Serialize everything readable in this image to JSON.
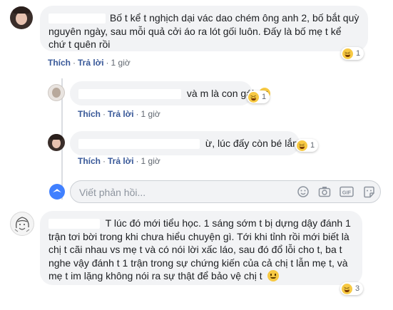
{
  "comments": [
    {
      "id": "c1",
      "text_line1": "Bố t kể t nghịch dại vác dao chém ông anh 2, bố bắt quỳ",
      "text_line2": "nguyên ngày, sau mỗi quả cởi áo ra lót gối luôn. Đấy là bố mẹ t kể",
      "text_line3": "chứ t quên rồi",
      "reaction_count": "1",
      "like": "Thích",
      "reply": "Trả lời",
      "time": "1 giờ"
    },
    {
      "id": "r1",
      "text": "và m là con gái",
      "reaction_count": "1",
      "like": "Thích",
      "reply": "Trả lời",
      "time": "1 giờ"
    },
    {
      "id": "r2",
      "text": "ừ, lúc đấy còn bé lắm",
      "reaction_count": "1",
      "like": "Thích",
      "reply": "Trả lời",
      "time": "1 giờ"
    },
    {
      "id": "c2",
      "text_line1": "T lúc đó mới tiểu học. 1 sáng sớm t bị dựng dậy đánh 1",
      "text_line2": "trận tơi bời trong khi chưa hiểu chuyện gì. Tới khi tỉnh rồi mới biết là",
      "text_line3": "chị t cãi nhau vs mẹ t và có nói lời xấc láo, sau đó đổ lỗi cho t, ba t",
      "text_line4": "nghe vậy đánh t 1 trận trong sự chứng kiến của cả chị t lẫn mẹ t, và",
      "text_line5": "mẹ t im lặng không nói ra sự thật để bảo vệ chị t",
      "reaction_count": "3"
    }
  ],
  "reply_input": {
    "placeholder": "Viết phản hồi..."
  },
  "icons": [
    "emoji-icon",
    "camera-icon",
    "gif-icon",
    "sticker-icon"
  ],
  "colors": {
    "link": "#385898",
    "bubble": "#f2f3f5",
    "meta": "#606770",
    "emoji": "#f7c943"
  }
}
